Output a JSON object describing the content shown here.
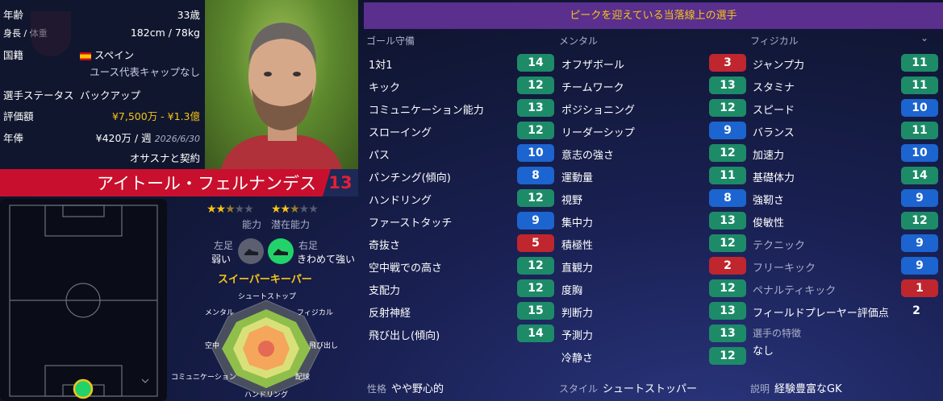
{
  "player": {
    "age_label": "年齢",
    "age": "33歳",
    "hw_label": "身長 / 体重",
    "hw": "182cm / 78kg",
    "nat_label": "国籍",
    "nationality": "スペイン",
    "youth_caps": "ユース代表キャップなし",
    "status_label": "選手ステータス",
    "status": "バックアップ",
    "value_label": "評価額",
    "value": "¥7,500万 - ¥1.3億",
    "wage_label": "年俸",
    "wage": "¥420万 / 週",
    "contract_date": "2026/6/30",
    "contract_text": "オサスナと契約",
    "name": "アイトール・フェルナンデス",
    "number": "13"
  },
  "ratings": {
    "ability_label": "能力",
    "potential_label": "潜在能力",
    "ability_stars": 2.5,
    "potential_stars": 2.5
  },
  "feet": {
    "left_label": "左足",
    "left_value": "弱い",
    "right_label": "右足",
    "right_value": "きわめて強い"
  },
  "role": "スイーパーキーパー",
  "radar_labels": {
    "top": "シュートストップ",
    "tr": "フィジカル",
    "r": "飛び出し",
    "br": "配球",
    "b": "ハンドリング",
    "bl": "コミュニケーション",
    "l": "空中",
    "tl": "メンタル"
  },
  "header": "ピークを迎えている当落線上の選手",
  "columns": {
    "gk": "ゴール守備",
    "mental": "メンタル",
    "physical": "フィジカル"
  },
  "gk_attrs": [
    {
      "name": "1対1",
      "value": "14",
      "color": "green"
    },
    {
      "name": "キック",
      "value": "12",
      "color": "green"
    },
    {
      "name": "コミュニケーション能力",
      "value": "13",
      "color": "green"
    },
    {
      "name": "スローイング",
      "value": "12",
      "color": "green"
    },
    {
      "name": "パス",
      "value": "10",
      "color": "blue"
    },
    {
      "name": "パンチング(傾向)",
      "value": "8",
      "color": "blue"
    },
    {
      "name": "ハンドリング",
      "value": "12",
      "color": "green"
    },
    {
      "name": "ファーストタッチ",
      "value": "9",
      "color": "blue"
    },
    {
      "name": "奇抜さ",
      "value": "5",
      "color": "red"
    },
    {
      "name": "空中戦での高さ",
      "value": "12",
      "color": "green"
    },
    {
      "name": "支配力",
      "value": "12",
      "color": "green"
    },
    {
      "name": "反射神経",
      "value": "15",
      "color": "green"
    },
    {
      "name": "飛び出し(傾向)",
      "value": "14",
      "color": "green"
    }
  ],
  "mental_attrs": [
    {
      "name": "オフザボール",
      "value": "3",
      "color": "red"
    },
    {
      "name": "チームワーク",
      "value": "13",
      "color": "green"
    },
    {
      "name": "ポジショニング",
      "value": "12",
      "color": "green"
    },
    {
      "name": "リーダーシップ",
      "value": "9",
      "color": "blue"
    },
    {
      "name": "意志の強さ",
      "value": "12",
      "color": "green"
    },
    {
      "name": "運動量",
      "value": "11",
      "color": "green"
    },
    {
      "name": "視野",
      "value": "8",
      "color": "blue"
    },
    {
      "name": "集中力",
      "value": "13",
      "color": "green"
    },
    {
      "name": "積極性",
      "value": "12",
      "color": "green"
    },
    {
      "name": "直観力",
      "value": "2",
      "color": "red"
    },
    {
      "name": "度胸",
      "value": "12",
      "color": "green"
    },
    {
      "name": "判断力",
      "value": "13",
      "color": "green"
    },
    {
      "name": "予測力",
      "value": "13",
      "color": "green"
    },
    {
      "name": "冷静さ",
      "value": "12",
      "color": "green"
    }
  ],
  "physical_attrs": [
    {
      "name": "ジャンプ力",
      "value": "11",
      "color": "green"
    },
    {
      "name": "スタミナ",
      "value": "11",
      "color": "green"
    },
    {
      "name": "スピード",
      "value": "10",
      "color": "blue"
    },
    {
      "name": "バランス",
      "value": "11",
      "color": "green"
    },
    {
      "name": "加速力",
      "value": "10",
      "color": "blue"
    },
    {
      "name": "基礎体力",
      "value": "14",
      "color": "green"
    },
    {
      "name": "強靭さ",
      "value": "9",
      "color": "blue"
    },
    {
      "name": "俊敏性",
      "value": "12",
      "color": "green"
    },
    {
      "name": "テクニック",
      "value": "9",
      "color": "blue",
      "dim": true
    },
    {
      "name": "フリーキック",
      "value": "9",
      "color": "blue",
      "dim": true
    },
    {
      "name": "ペナルティキック",
      "value": "1",
      "color": "red",
      "dim": true
    },
    {
      "name": "フィールドプレーヤー評価点",
      "value": "2",
      "color": "plain"
    }
  ],
  "traits": {
    "label": "選手の特徴",
    "value": "なし"
  },
  "footer": {
    "personality_label": "性格",
    "personality": "やや野心的",
    "style_label": "スタイル",
    "style": "シュートストッパー",
    "desc_label": "説明",
    "desc": "経験豊富なGK"
  },
  "colors": {
    "green": "#1d8b68",
    "blue": "#1c64d0",
    "red": "#c0262d",
    "header": "#5a2f8e",
    "namebar": "#c8102e"
  }
}
